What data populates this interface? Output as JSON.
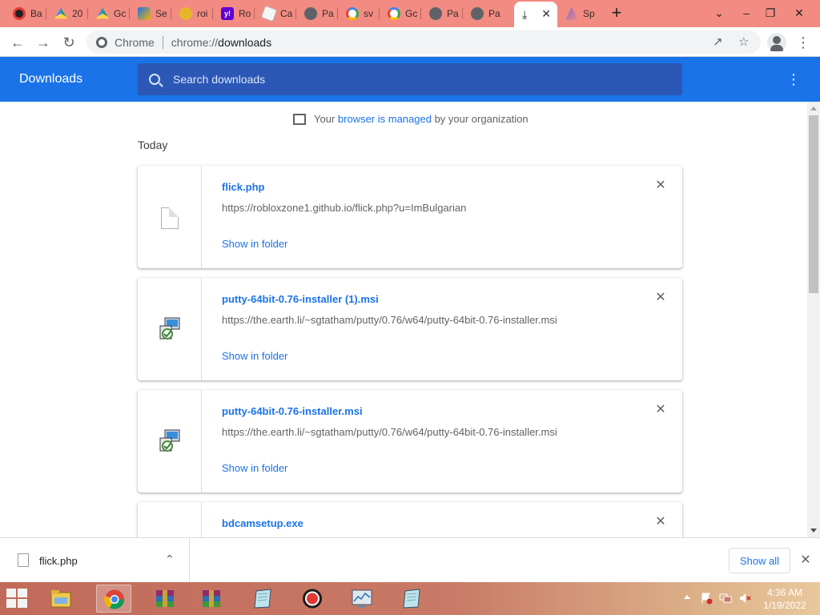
{
  "browser": {
    "tabs": [
      {
        "label": "Ba",
        "icon": "record-icon",
        "color": "#202124"
      },
      {
        "label": "20",
        "icon": "drive-icon",
        "color": "#1fa463"
      },
      {
        "label": "Gc",
        "icon": "drive-icon",
        "color": "#1fa463"
      },
      {
        "label": "Se",
        "icon": "bing-icon",
        "color": "#1a73e8"
      },
      {
        "label": "roi",
        "icon": "roi-icon",
        "color": "#e6b62a"
      },
      {
        "label": "Ro",
        "icon": "yahoo-icon",
        "color": "#6001d2"
      },
      {
        "label": "Ca",
        "icon": "edit-icon",
        "color": "#e8e8e8"
      },
      {
        "label": "Pa",
        "icon": "globe-icon",
        "color": "#5f6368"
      },
      {
        "label": "sv",
        "icon": "google-icon",
        "color": "#4285f4"
      },
      {
        "label": "Gc",
        "icon": "google-icon",
        "color": "#4285f4"
      },
      {
        "label": "Pa",
        "icon": "globe-icon",
        "color": "#5f6368"
      },
      {
        "label": "Pa",
        "icon": "globe-icon",
        "color": "#5f6368"
      },
      {
        "label": "",
        "icon": "download-icon",
        "color": "#202124",
        "active": true
      },
      {
        "label": "Sp",
        "icon": "prism-icon",
        "color": "#7c6bd6"
      }
    ],
    "omnibox": {
      "label": "Chrome",
      "scheme": "chrome://",
      "path": "downloads"
    }
  },
  "downloads": {
    "title": "Downloads",
    "search_placeholder": "Search downloads",
    "managed": {
      "prefix": "Your ",
      "link": "browser is managed",
      "suffix": " by your organization"
    },
    "section": "Today",
    "items": [
      {
        "name": "flick.php",
        "url": "https://robloxzone1.github.io/flick.php?u=ImBulgarian",
        "action": "Show in folder",
        "icon": "file-icon"
      },
      {
        "name": "putty-64bit-0.76-installer (1).msi",
        "url": "https://the.earth.li/~sgtatham/putty/0.76/w64/putty-64bit-0.76-installer.msi",
        "action": "Show in folder",
        "icon": "msi-installer-icon"
      },
      {
        "name": "putty-64bit-0.76-installer.msi",
        "url": "https://the.earth.li/~sgtatham/putty/0.76/w64/putty-64bit-0.76-installer.msi",
        "action": "Show in folder",
        "icon": "msi-installer-icon"
      },
      {
        "name": "bdcamsetup.exe",
        "url": "",
        "action": "",
        "icon": "exe-icon"
      }
    ]
  },
  "shelf": {
    "file_name": "flick.php",
    "show_all_label": "Show all"
  },
  "taskbar": {
    "time": "4:36 AM",
    "date": "1/19/2022"
  },
  "colors": {
    "accent": "#1a73e8",
    "tabstrip": "#f28b82"
  }
}
